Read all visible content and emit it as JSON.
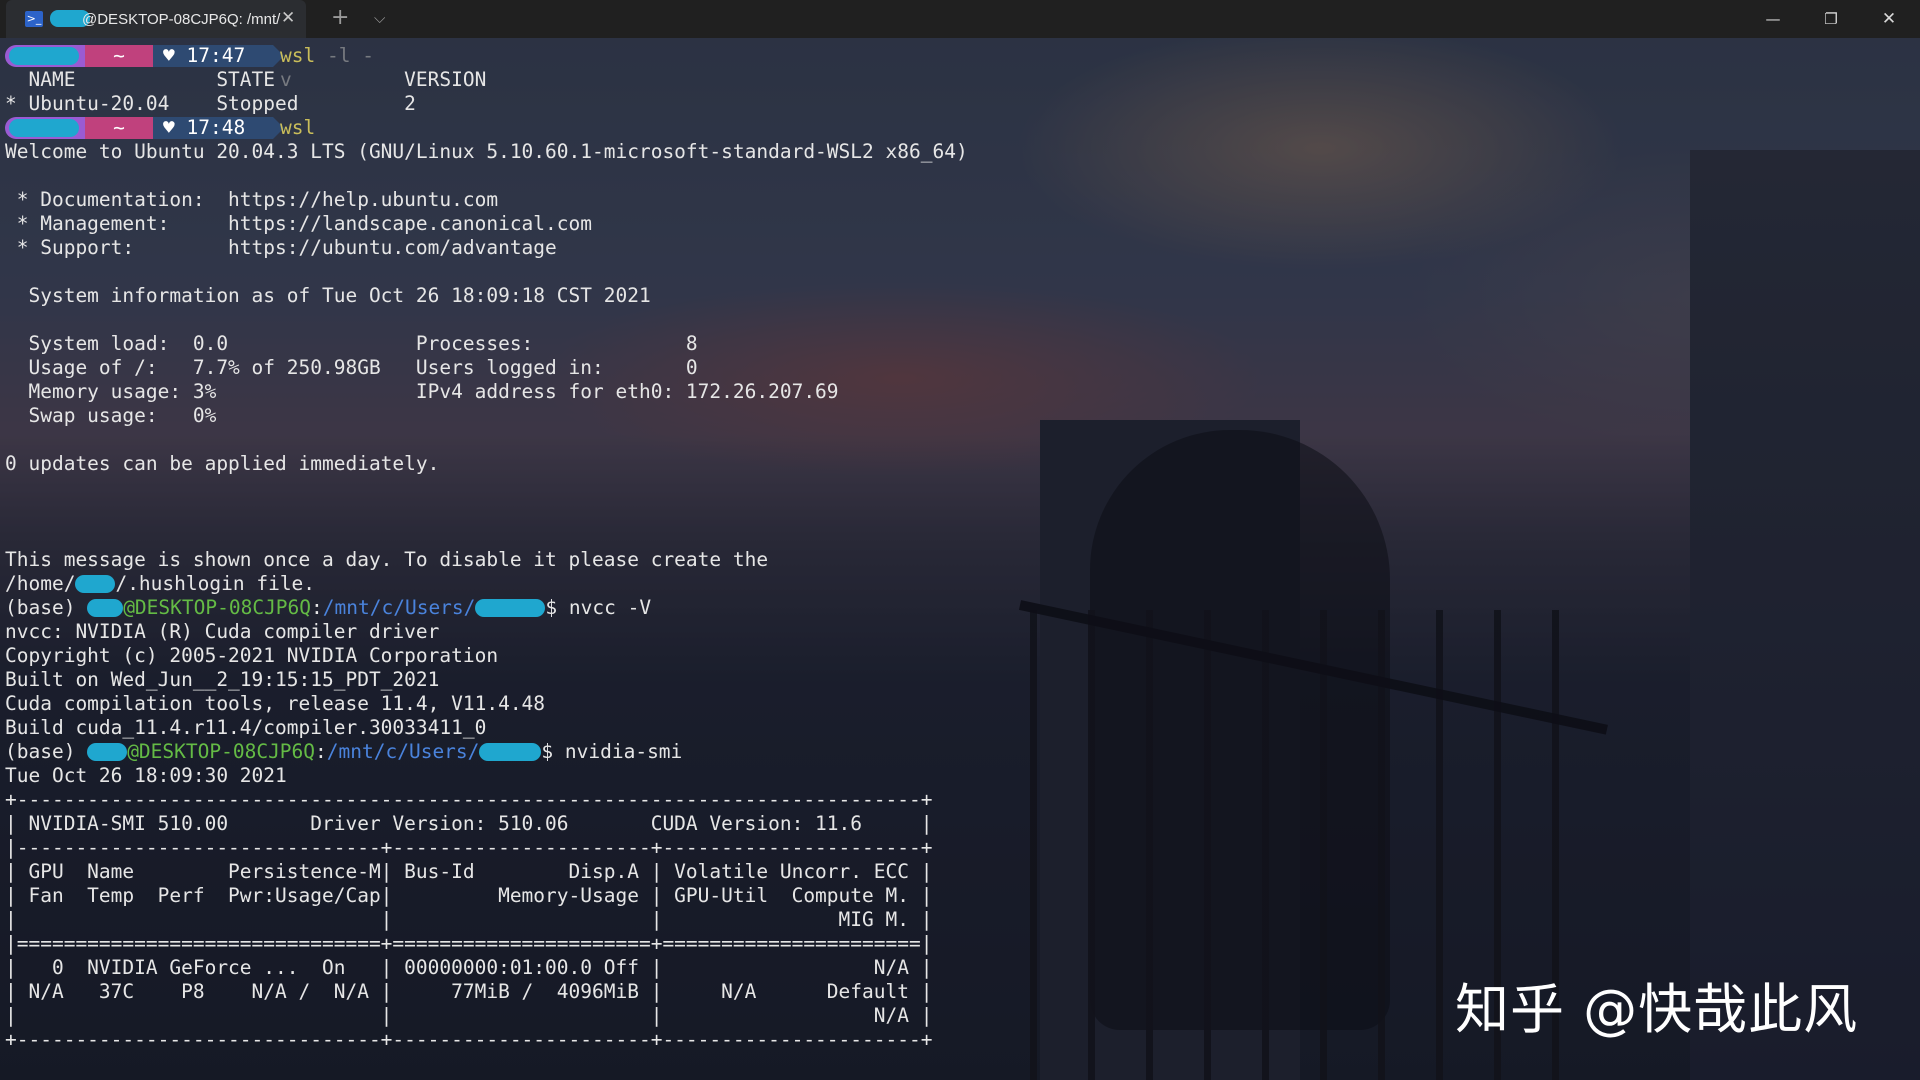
{
  "titlebar": {
    "tab_title": "@DESKTOP-08CJP6Q: /mnt/",
    "tab_icon": "powershell-icon",
    "close_tab_glyph": "✕",
    "new_tab_glyph": "+",
    "dropdown_glyph": "⌵",
    "minimize_glyph": "—",
    "restore_glyph": "❐",
    "close_glyph": "✕"
  },
  "prompts": [
    {
      "dir": "~",
      "time": "♥ 17:47",
      "command": "wsl",
      "args": " -l -v"
    },
    {
      "dir": "~",
      "time": "♥ 17:48",
      "command": "wsl",
      "args": ""
    }
  ],
  "lines": {
    "l1": "  NAME            STATE           VERSION",
    "l2": "* Ubuntu-20.04    Stopped         2",
    "l3": "Welcome to Ubuntu 20.04.3 LTS (GNU/Linux 5.10.60.1-microsoft-standard-WSL2 x86_64)",
    "l4": " * Documentation:  https://help.ubuntu.com",
    "l5": " * Management:     https://landscape.canonical.com",
    "l6": " * Support:        https://ubuntu.com/advantage",
    "l7": "  System information as of Tue Oct 26 18:09:18 CST 2021",
    "l8": "  System load:  0.0                Processes:             8",
    "l9": "  Usage of /:   7.7% of 250.98GB   Users logged in:       0",
    "l10": "  Memory usage: 3%                 IPv4 address for eth0: 172.26.207.69",
    "l11": "  Swap usage:   0%",
    "l12": "0 updates can be applied immediately.",
    "l13": "This message is shown once a day. To disable it please create the",
    "l14a": "/home/",
    "l14b": "/.hushlogin file.",
    "nvcc_out1": "nvcc: NVIDIA (R) Cuda compiler driver",
    "nvcc_out2": "Copyright (c) 2005-2021 NVIDIA Corporation",
    "nvcc_out3": "Built on Wed_Jun__2_19:15:15_PDT_2021",
    "nvcc_out4": "Cuda compilation tools, release 11.4, V11.4.48",
    "nvcc_out5": "Build cuda_11.4.r11.4/compiler.30033411_0",
    "date": "Tue Oct 26 18:09:30 2021",
    "t1": "+-----------------------------------------------------------------------------+",
    "t2": "| NVIDIA-SMI 510.00       Driver Version: 510.06       CUDA Version: 11.6     |",
    "t3": "|-------------------------------+----------------------+----------------------+",
    "t4": "| GPU  Name        Persistence-M| Bus-Id        Disp.A | Volatile Uncorr. ECC |",
    "t5": "| Fan  Temp  Perf  Pwr:Usage/Cap|         Memory-Usage | GPU-Util  Compute M. |",
    "t6": "|                               |                      |               MIG M. |",
    "t7": "|===============================+======================+======================|",
    "t8": "|   0  NVIDIA GeForce ...  On   | 00000000:01:00.0 Off |                  N/A |",
    "t9": "| N/A   37C    P8    N/A /  N/A |     77MiB /  4096MiB |     N/A      Default |",
    "t10": "|                               |                      |                  N/A |",
    "t11": "+-------------------------------+----------------------+----------------------+"
  },
  "shell_prompts": [
    {
      "env": "(base) ",
      "host": "@DESKTOP-08CJP6Q",
      "colon": ":",
      "path": "/mnt/c/Users/",
      "dollar": "$ ",
      "command": "nvcc -V"
    },
    {
      "env": "(base) ",
      "host": "@DESKTOP-08CJP6Q",
      "colon": ":",
      "path": "/mnt/c/Users/",
      "dollar": "$ ",
      "command": "nvidia-smi"
    }
  ],
  "watermark": "知乎 @快哉此风",
  "colors": {
    "prompt_purple": "#9a5bd3",
    "prompt_pink": "#c0417d",
    "prompt_blue": "#2e4a72",
    "redaction_cyan": "#1fa7cf",
    "host_green": "#64bb45",
    "path_blue": "#4a83dc",
    "command_yellow": "#c9bd5a"
  }
}
